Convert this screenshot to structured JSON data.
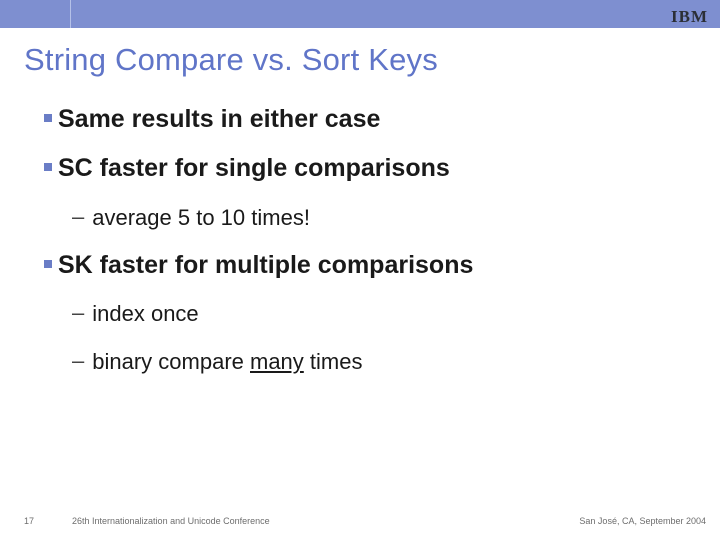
{
  "header": {
    "logo_text": "IBM"
  },
  "title": "String Compare vs. Sort Keys",
  "bullets": {
    "b1": "Same results in either case",
    "b2": "SC faster for single comparisons",
    "b2_sub1": "average 5 to 10 times!",
    "b3": "SK faster for multiple comparisons",
    "b3_sub1": "index once",
    "b3_sub2_pre": "binary compare ",
    "b3_sub2_underlined": "many",
    "b3_sub2_post": " times"
  },
  "footer": {
    "page_number": "17",
    "conference": "26th Internationalization and Unicode Conference",
    "location": "San José, CA, September 2004"
  },
  "colors": {
    "accent": "#6075c8",
    "topbar": "#7e8fd0"
  }
}
